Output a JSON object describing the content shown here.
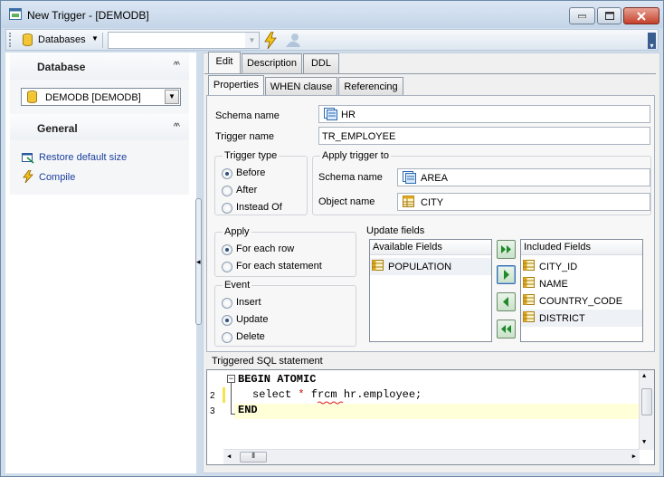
{
  "window": {
    "title": "New Trigger - [DEMODB]"
  },
  "toolbar": {
    "databases_label": "Databases"
  },
  "left": {
    "database_header": "Database",
    "database_value": "DEMODB [DEMODB]",
    "general_header": "General",
    "links": [
      "Restore default size",
      "Compile"
    ]
  },
  "tabs": [
    "Edit",
    "Description",
    "DDL"
  ],
  "subtabs": [
    "Properties",
    "WHEN clause",
    "Referencing"
  ],
  "form": {
    "schema_label": "Schema name",
    "schema_value": "HR",
    "trigger_label": "Trigger name",
    "trigger_value": "TR_EMPLOYEE"
  },
  "trigger_type": {
    "title": "Trigger type",
    "options": [
      "Before",
      "After",
      "Instead Of"
    ],
    "selected": "Before"
  },
  "apply_to": {
    "title": "Apply trigger to",
    "schema_label": "Schema name",
    "schema_value": "AREA",
    "object_label": "Object name",
    "object_value": "CITY"
  },
  "apply": {
    "title": "Apply",
    "options": [
      "For each row",
      "For each statement"
    ],
    "selected": "For each row"
  },
  "event": {
    "title": "Event",
    "options": [
      "Insert",
      "Update",
      "Delete"
    ],
    "selected": "Update"
  },
  "update_fields": {
    "title": "Update fields",
    "available_header": "Available Fields",
    "available": [
      "POPULATION"
    ],
    "included_header": "Included Fields",
    "included": [
      "CITY_ID",
      "NAME",
      "COUNTRY_CODE",
      "DISTRICT"
    ]
  },
  "sql": {
    "label": "Triggered SQL statement",
    "line_numbers": [
      "2",
      "3"
    ],
    "lines": [
      "BEGIN ATOMIC",
      "select * frcm hr.employee;",
      "END"
    ]
  },
  "colors": {
    "accent": "#1a3f9c",
    "title_bg": "#c4d5e8",
    "highlight": "#ffffd8"
  }
}
